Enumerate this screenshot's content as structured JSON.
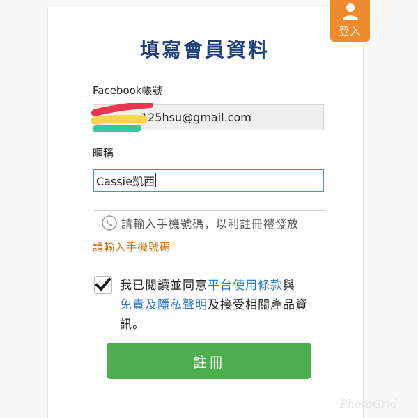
{
  "login": {
    "label": "登入"
  },
  "form": {
    "title": "填寫會員資料",
    "facebook_label": "Facebook帳號",
    "facebook_value": "125hsu@gmail.com",
    "nickname_label": "暱稱",
    "nickname_value": "Cassie凱西",
    "phone_placeholder": "請輸入手機號碼，以利註冊禮發放",
    "phone_error": "請輸入手機號碼",
    "agree_text_1": "我已閱讀並同意",
    "agree_link_1": "平台使用條款",
    "agree_text_2": "與",
    "agree_link_2": "免責及隱私聲明",
    "agree_text_3": "及接受相關產品資訊。",
    "agree_checked": true,
    "register_label": "註冊"
  },
  "watermark": "PhotoGrid",
  "colors": {
    "title": "#1e3f7a",
    "login_tab": "#f08a2e",
    "register_button": "#4cae4c",
    "link": "#2e78c5",
    "error": "#c8741a",
    "focus_border": "#4a8fd0"
  }
}
